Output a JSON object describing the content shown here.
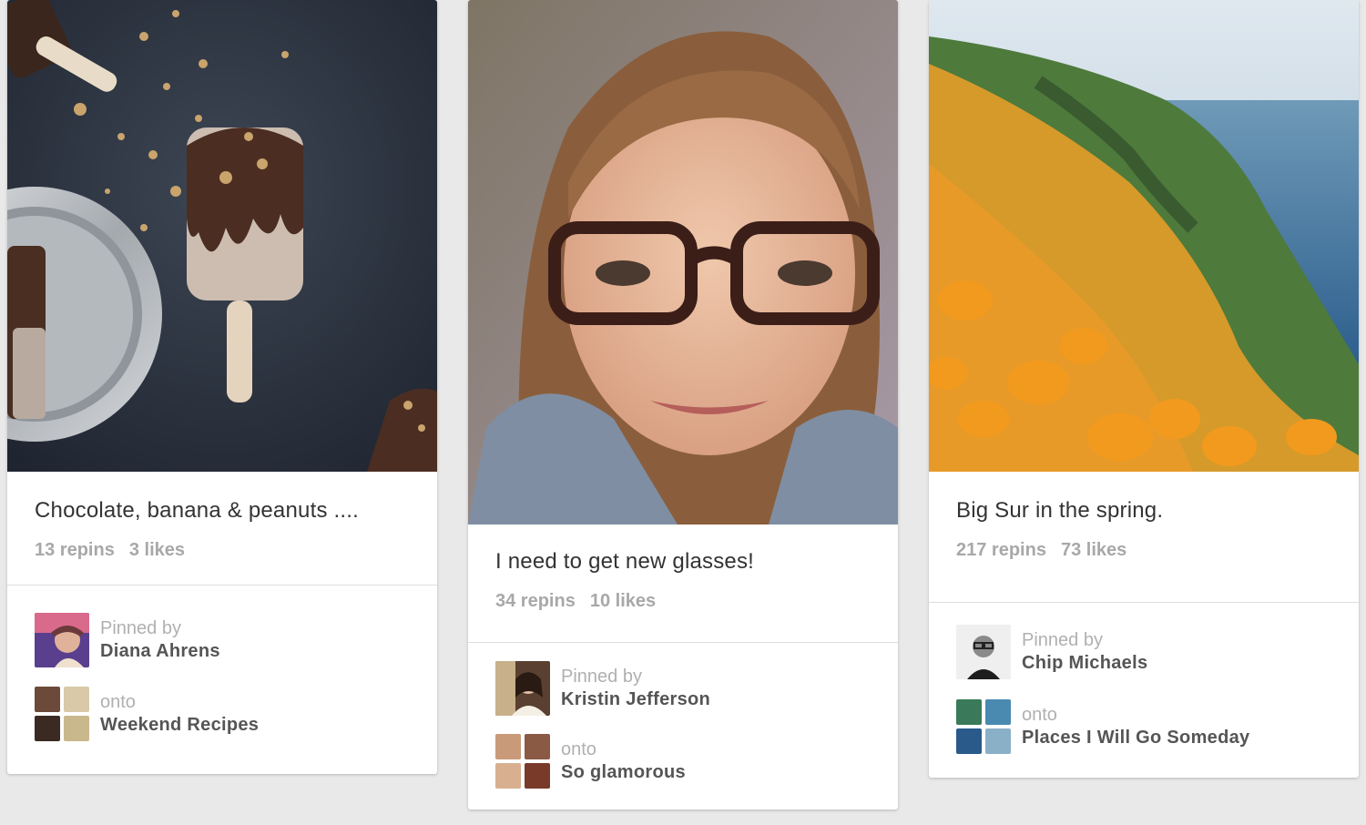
{
  "pins": [
    {
      "image_icon": "popsicles-photo",
      "description": "Chocolate, banana & peanuts ....",
      "repins": "13 repins",
      "likes": "3 likes",
      "pinned_by_label": "Pinned by",
      "pinner": "Diana Ahrens",
      "onto_label": "onto",
      "board": "Weekend Recipes",
      "thumb_colors": [
        "#6b4a3a",
        "#d9c9a8",
        "#3b2a22",
        "#c9b88c"
      ]
    },
    {
      "image_icon": "portrait-photo",
      "description": "I need to get new glasses!",
      "repins": "34 repins",
      "likes": "10 likes",
      "pinned_by_label": "Pinned by",
      "pinner": "Kristin Jefferson",
      "onto_label": "onto",
      "board": "So glamorous",
      "thumb_colors": [
        "#c99a7a",
        "#8a5a44",
        "#d8b090",
        "#7a3a2a"
      ]
    },
    {
      "image_icon": "landscape-photo",
      "description": "Big Sur in the spring.",
      "repins": "217 repins",
      "likes": "73 likes",
      "pinned_by_label": "Pinned by",
      "pinner": "Chip Michaels",
      "onto_label": "onto",
      "board": "Places I Will Go Someday",
      "thumb_colors": [
        "#3a7a5a",
        "#4a8ab0",
        "#2a5a8a",
        "#8ab0c8"
      ]
    }
  ]
}
